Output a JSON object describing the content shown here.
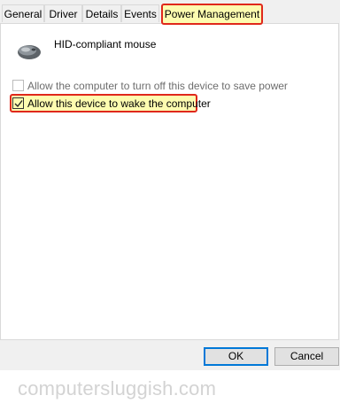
{
  "tabs": [
    {
      "label": "General"
    },
    {
      "label": "Driver"
    },
    {
      "label": "Details"
    },
    {
      "label": "Events"
    },
    {
      "label": "Power Management",
      "selected": true
    }
  ],
  "device": {
    "name": "HID-compliant mouse",
    "icon": "mouse-icon"
  },
  "options": {
    "turn_off": {
      "label": "Allow the computer to turn off this device to save power",
      "checked": false,
      "enabled": false
    },
    "wake": {
      "label": "Allow this device to wake the computer",
      "checked": true,
      "enabled": true
    }
  },
  "buttons": {
    "ok": "OK",
    "cancel": "Cancel"
  },
  "watermark": "computersluggish.com",
  "colors": {
    "highlight_fill": "#fdfcb0",
    "highlight_border": "#e0281b",
    "default_button_border": "#0078d7"
  }
}
